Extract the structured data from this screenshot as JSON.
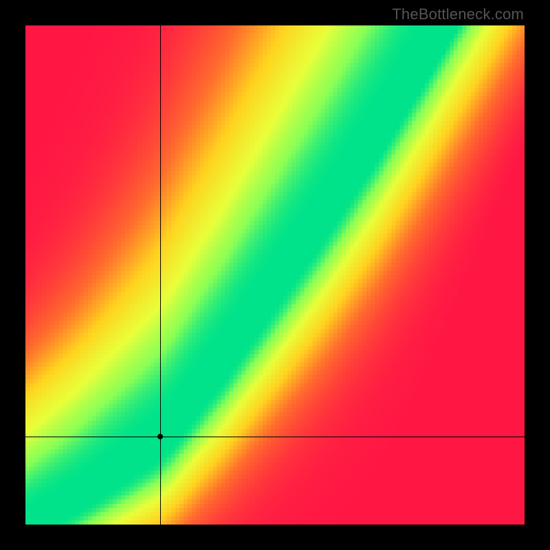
{
  "watermark": "TheBottleneck.com",
  "chart_data": {
    "type": "heatmap",
    "title": "",
    "xlabel": "",
    "ylabel": "",
    "xlim": [
      0,
      1
    ],
    "ylim": [
      0,
      1
    ],
    "crosshair": {
      "x": 0.27,
      "y": 0.176
    },
    "marked_point": {
      "x": 0.27,
      "y": 0.176
    },
    "optimal_ridge": {
      "description": "green band of optimal pairing; approximate (x,y) centerline",
      "points": [
        {
          "x": 0.0,
          "y": 0.0
        },
        {
          "x": 0.1,
          "y": 0.055
        },
        {
          "x": 0.2,
          "y": 0.125
        },
        {
          "x": 0.27,
          "y": 0.176
        },
        {
          "x": 0.3,
          "y": 0.21
        },
        {
          "x": 0.4,
          "y": 0.34
        },
        {
          "x": 0.5,
          "y": 0.48
        },
        {
          "x": 0.6,
          "y": 0.62
        },
        {
          "x": 0.7,
          "y": 0.77
        },
        {
          "x": 0.78,
          "y": 0.9
        },
        {
          "x": 0.84,
          "y": 1.0
        }
      ]
    },
    "color_scale": {
      "0.0": "#ff1744",
      "0.3": "#ff6d2d",
      "0.55": "#ffd21f",
      "0.78": "#e8ff3a",
      "0.92": "#8bff55",
      "1.0": "#00e38a"
    }
  }
}
